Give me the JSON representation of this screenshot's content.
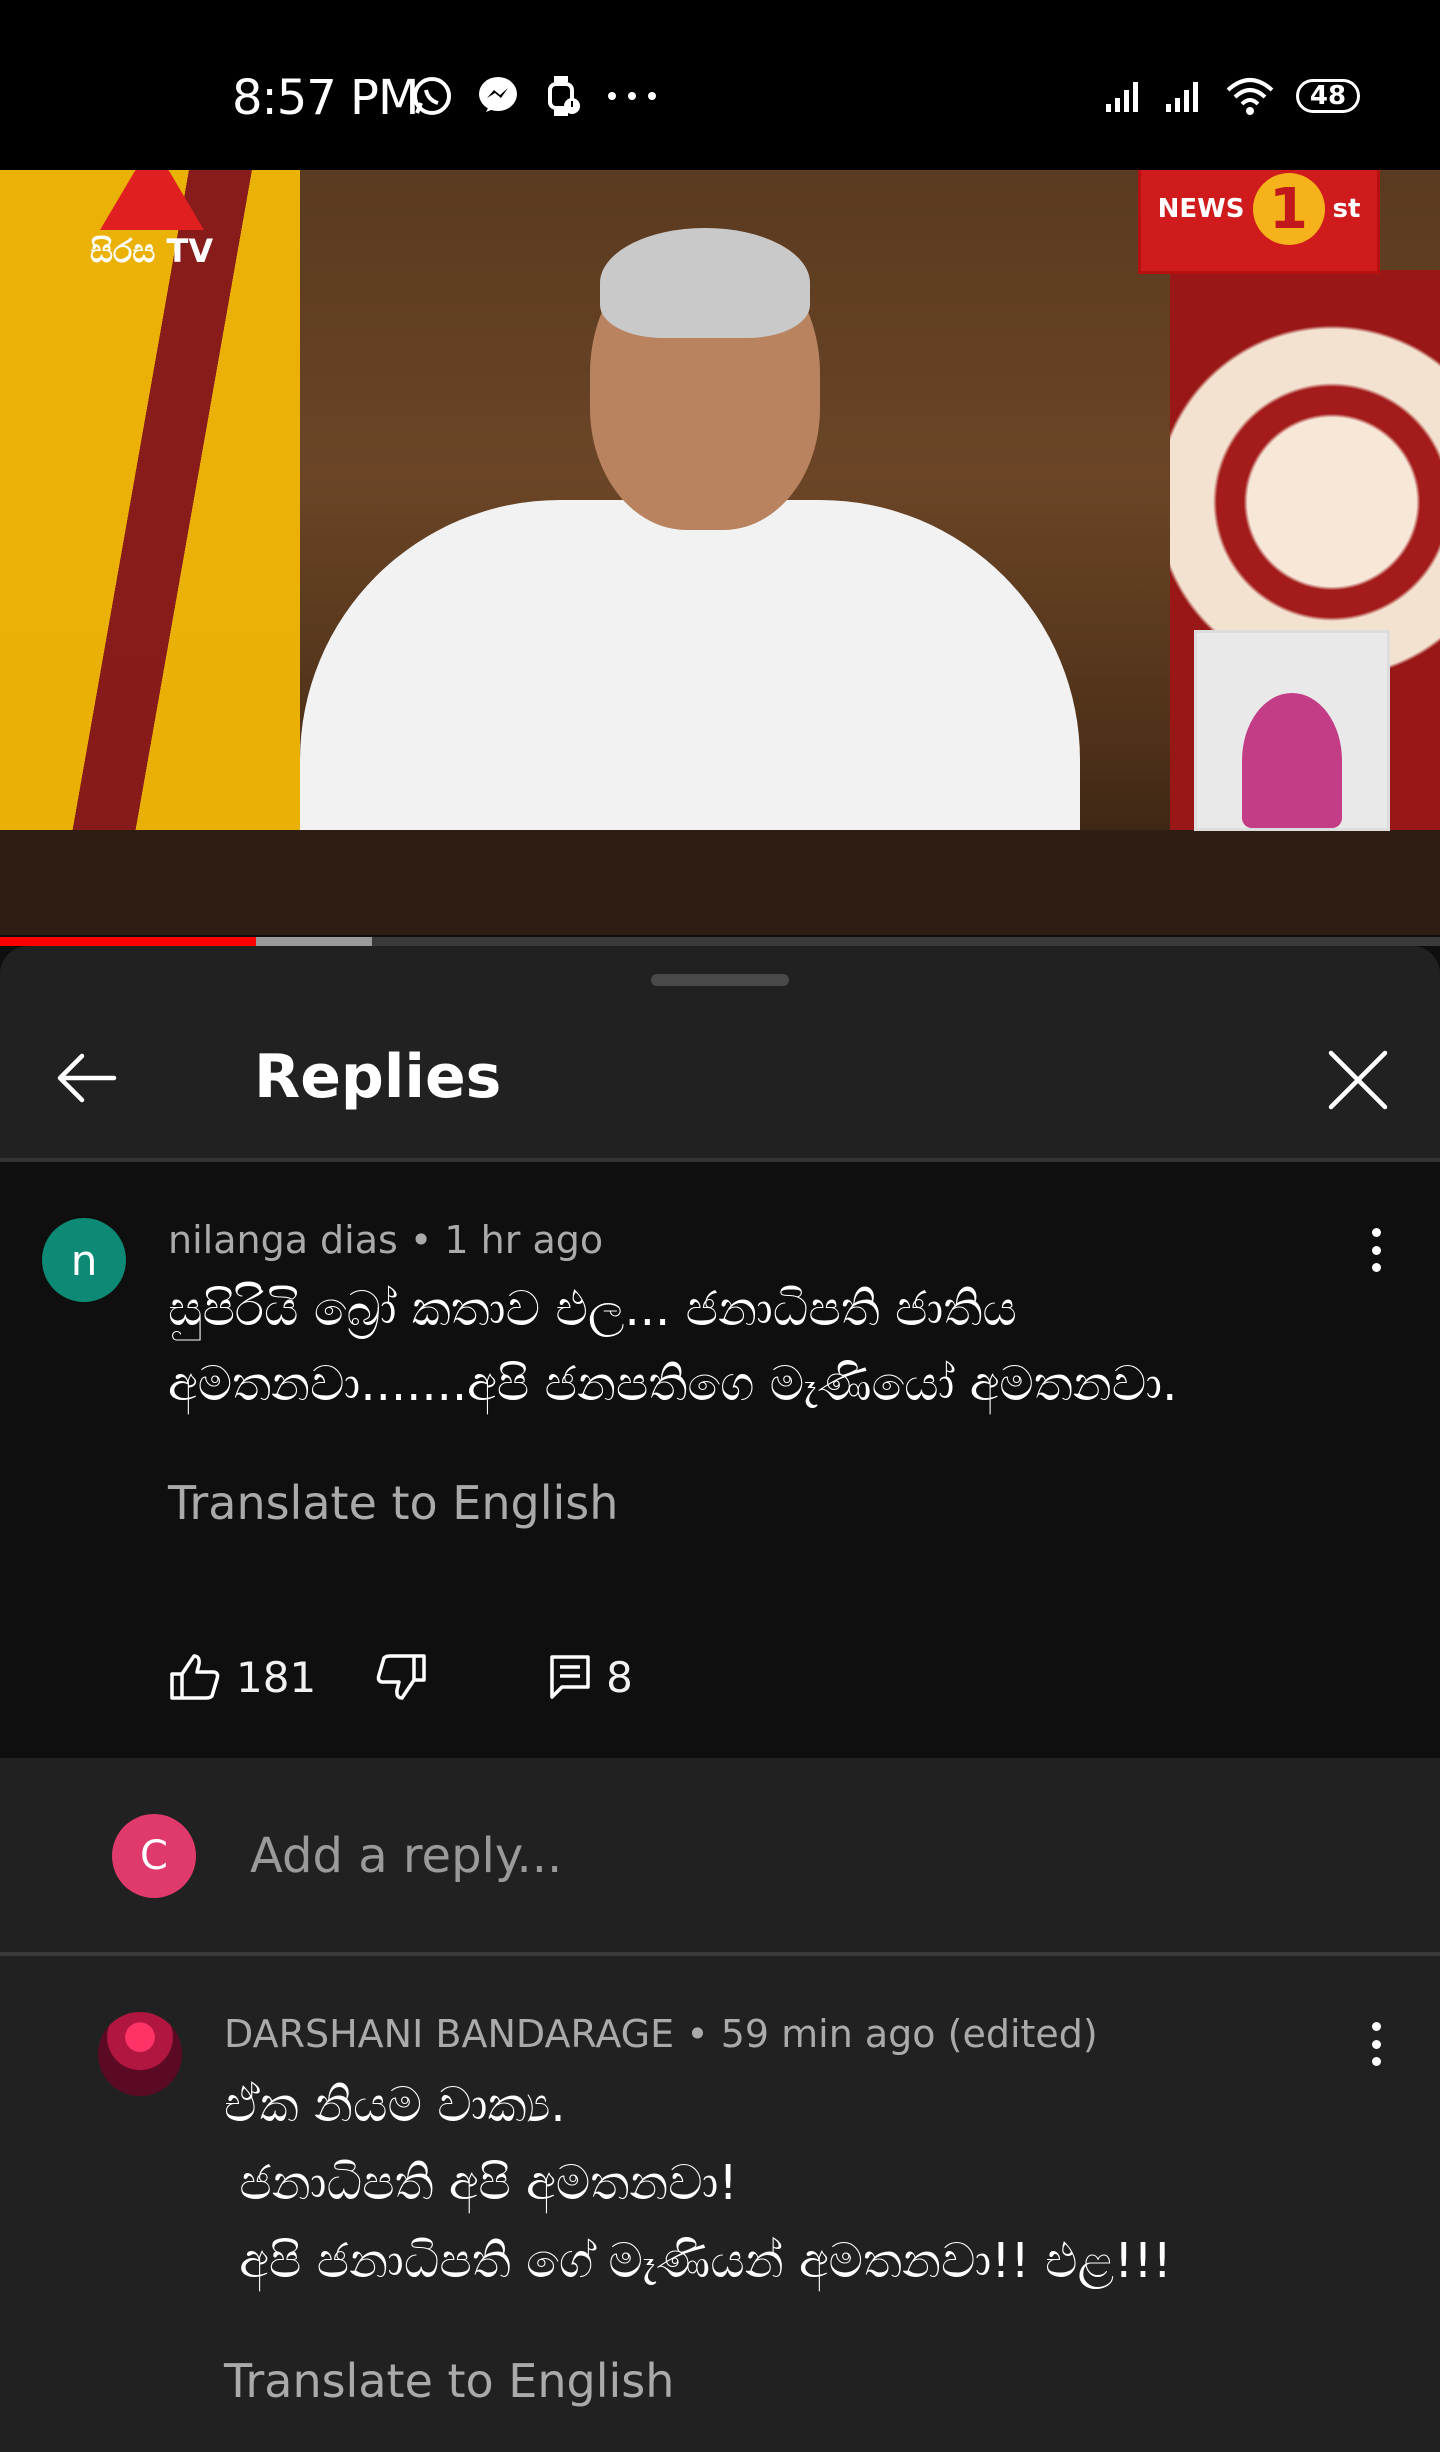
{
  "status_bar": {
    "time": "8:57 PM",
    "battery": "48"
  },
  "video": {
    "channel_logo_text": "සිරස TV",
    "news_badge_left": "NEWS",
    "news_badge_number": "1",
    "news_badge_right": "st",
    "progress_played": 0.178,
    "progress_buffered": 0.258
  },
  "sheet": {
    "title": "Replies"
  },
  "main_comment": {
    "avatar_letter": "n",
    "author": "nilanga dias",
    "time": "1 hr ago",
    "text": "සුපිරියි බ්‍රෝ කතාව එල... ජනාධිපති ජාතිය\nඅමතනවා.......අපි ජනපතිගෙ මෑණියෝ අමතනවා.",
    "translate_label": "Translate to English",
    "likes": "181",
    "replies_count": "8"
  },
  "reply_box": {
    "avatar_letter": "C",
    "placeholder": "Add a reply..."
  },
  "reply_comment": {
    "author": "DARSHANI BANDARAGE",
    "time": "59 min ago (edited)",
    "text": "ඒක නියම වාක්‍ය.\n ජනාධිපති අපි අමතනවා!\n අපි ජනාධිපති ගේ මෑණියන් අමතනවා!! එළ!!!",
    "translate_label": "Translate to English"
  },
  "colors": {
    "background": "#0f0f0f",
    "sheet": "#212121",
    "progress": "#ff0000",
    "secondary_text": "#aaaaaa"
  }
}
